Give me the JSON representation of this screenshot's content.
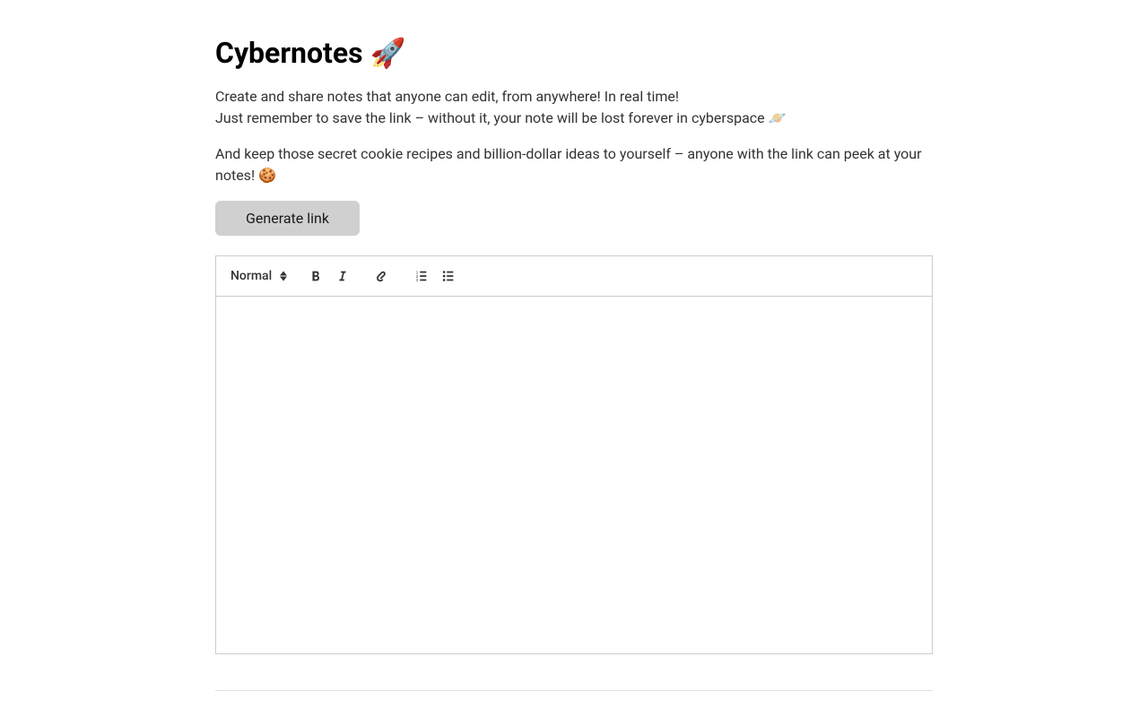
{
  "header": {
    "title": "Cybernotes 🚀",
    "intro_line1": "Create and share notes that anyone can edit, from anywhere! In real time!",
    "intro_line2": "Just remember to save the link – without it, your note will be lost forever in cyberspace 🪐",
    "intro_line3": "And keep those secret cookie recipes and billion-dollar ideas to yourself – anyone with the link can peek at your notes! 🍪"
  },
  "actions": {
    "generate_link_label": "Generate link"
  },
  "editor": {
    "format_select": {
      "selected": "Normal",
      "options": [
        "Normal"
      ]
    },
    "content": ""
  }
}
